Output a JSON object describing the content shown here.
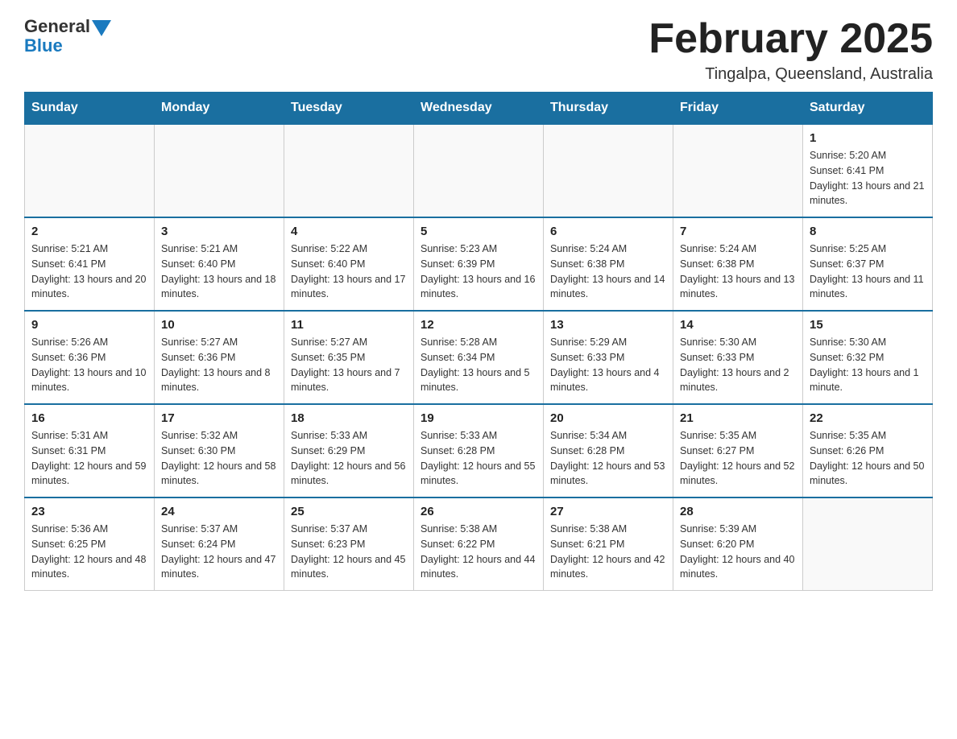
{
  "logo": {
    "general": "General",
    "blue": "Blue"
  },
  "title": "February 2025",
  "location": "Tingalpa, Queensland, Australia",
  "days_of_week": [
    "Sunday",
    "Monday",
    "Tuesday",
    "Wednesday",
    "Thursday",
    "Friday",
    "Saturday"
  ],
  "weeks": [
    [
      {
        "day": "",
        "info": ""
      },
      {
        "day": "",
        "info": ""
      },
      {
        "day": "",
        "info": ""
      },
      {
        "day": "",
        "info": ""
      },
      {
        "day": "",
        "info": ""
      },
      {
        "day": "",
        "info": ""
      },
      {
        "day": "1",
        "info": "Sunrise: 5:20 AM\nSunset: 6:41 PM\nDaylight: 13 hours and 21 minutes."
      }
    ],
    [
      {
        "day": "2",
        "info": "Sunrise: 5:21 AM\nSunset: 6:41 PM\nDaylight: 13 hours and 20 minutes."
      },
      {
        "day": "3",
        "info": "Sunrise: 5:21 AM\nSunset: 6:40 PM\nDaylight: 13 hours and 18 minutes."
      },
      {
        "day": "4",
        "info": "Sunrise: 5:22 AM\nSunset: 6:40 PM\nDaylight: 13 hours and 17 minutes."
      },
      {
        "day": "5",
        "info": "Sunrise: 5:23 AM\nSunset: 6:39 PM\nDaylight: 13 hours and 16 minutes."
      },
      {
        "day": "6",
        "info": "Sunrise: 5:24 AM\nSunset: 6:38 PM\nDaylight: 13 hours and 14 minutes."
      },
      {
        "day": "7",
        "info": "Sunrise: 5:24 AM\nSunset: 6:38 PM\nDaylight: 13 hours and 13 minutes."
      },
      {
        "day": "8",
        "info": "Sunrise: 5:25 AM\nSunset: 6:37 PM\nDaylight: 13 hours and 11 minutes."
      }
    ],
    [
      {
        "day": "9",
        "info": "Sunrise: 5:26 AM\nSunset: 6:36 PM\nDaylight: 13 hours and 10 minutes."
      },
      {
        "day": "10",
        "info": "Sunrise: 5:27 AM\nSunset: 6:36 PM\nDaylight: 13 hours and 8 minutes."
      },
      {
        "day": "11",
        "info": "Sunrise: 5:27 AM\nSunset: 6:35 PM\nDaylight: 13 hours and 7 minutes."
      },
      {
        "day": "12",
        "info": "Sunrise: 5:28 AM\nSunset: 6:34 PM\nDaylight: 13 hours and 5 minutes."
      },
      {
        "day": "13",
        "info": "Sunrise: 5:29 AM\nSunset: 6:33 PM\nDaylight: 13 hours and 4 minutes."
      },
      {
        "day": "14",
        "info": "Sunrise: 5:30 AM\nSunset: 6:33 PM\nDaylight: 13 hours and 2 minutes."
      },
      {
        "day": "15",
        "info": "Sunrise: 5:30 AM\nSunset: 6:32 PM\nDaylight: 13 hours and 1 minute."
      }
    ],
    [
      {
        "day": "16",
        "info": "Sunrise: 5:31 AM\nSunset: 6:31 PM\nDaylight: 12 hours and 59 minutes."
      },
      {
        "day": "17",
        "info": "Sunrise: 5:32 AM\nSunset: 6:30 PM\nDaylight: 12 hours and 58 minutes."
      },
      {
        "day": "18",
        "info": "Sunrise: 5:33 AM\nSunset: 6:29 PM\nDaylight: 12 hours and 56 minutes."
      },
      {
        "day": "19",
        "info": "Sunrise: 5:33 AM\nSunset: 6:28 PM\nDaylight: 12 hours and 55 minutes."
      },
      {
        "day": "20",
        "info": "Sunrise: 5:34 AM\nSunset: 6:28 PM\nDaylight: 12 hours and 53 minutes."
      },
      {
        "day": "21",
        "info": "Sunrise: 5:35 AM\nSunset: 6:27 PM\nDaylight: 12 hours and 52 minutes."
      },
      {
        "day": "22",
        "info": "Sunrise: 5:35 AM\nSunset: 6:26 PM\nDaylight: 12 hours and 50 minutes."
      }
    ],
    [
      {
        "day": "23",
        "info": "Sunrise: 5:36 AM\nSunset: 6:25 PM\nDaylight: 12 hours and 48 minutes."
      },
      {
        "day": "24",
        "info": "Sunrise: 5:37 AM\nSunset: 6:24 PM\nDaylight: 12 hours and 47 minutes."
      },
      {
        "day": "25",
        "info": "Sunrise: 5:37 AM\nSunset: 6:23 PM\nDaylight: 12 hours and 45 minutes."
      },
      {
        "day": "26",
        "info": "Sunrise: 5:38 AM\nSunset: 6:22 PM\nDaylight: 12 hours and 44 minutes."
      },
      {
        "day": "27",
        "info": "Sunrise: 5:38 AM\nSunset: 6:21 PM\nDaylight: 12 hours and 42 minutes."
      },
      {
        "day": "28",
        "info": "Sunrise: 5:39 AM\nSunset: 6:20 PM\nDaylight: 12 hours and 40 minutes."
      },
      {
        "day": "",
        "info": ""
      }
    ]
  ]
}
